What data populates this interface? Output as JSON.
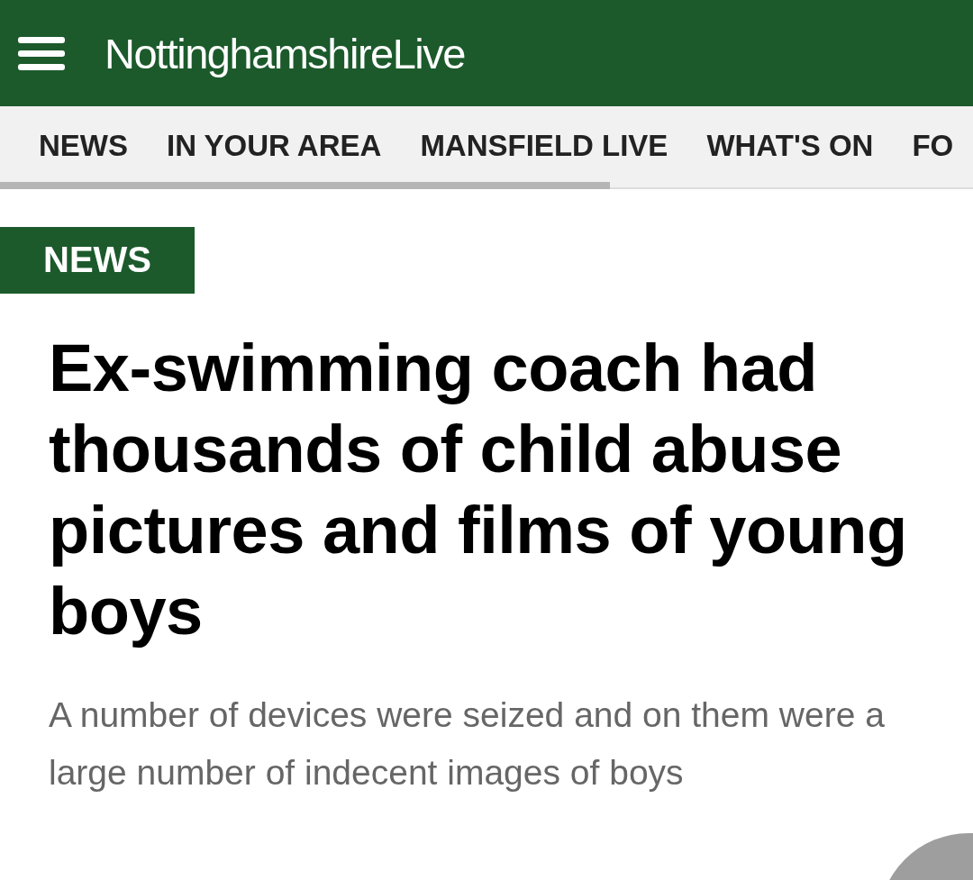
{
  "header": {
    "logo": "**Nottinghamshire**Live"
  },
  "nav": {
    "items": [
      {
        "label": "NEWS"
      },
      {
        "label": "IN YOUR AREA"
      },
      {
        "label": "MANSFIELD LIVE"
      },
      {
        "label": "WHAT'S ON"
      },
      {
        "label": "FO"
      }
    ]
  },
  "article": {
    "section_tag": "NEWS",
    "headline": "Ex-swimming coach had thousands of child abuse pictures and films of young boys",
    "standfirst": "A number of devices were seized and on them were a large number of indecent images of boys"
  }
}
